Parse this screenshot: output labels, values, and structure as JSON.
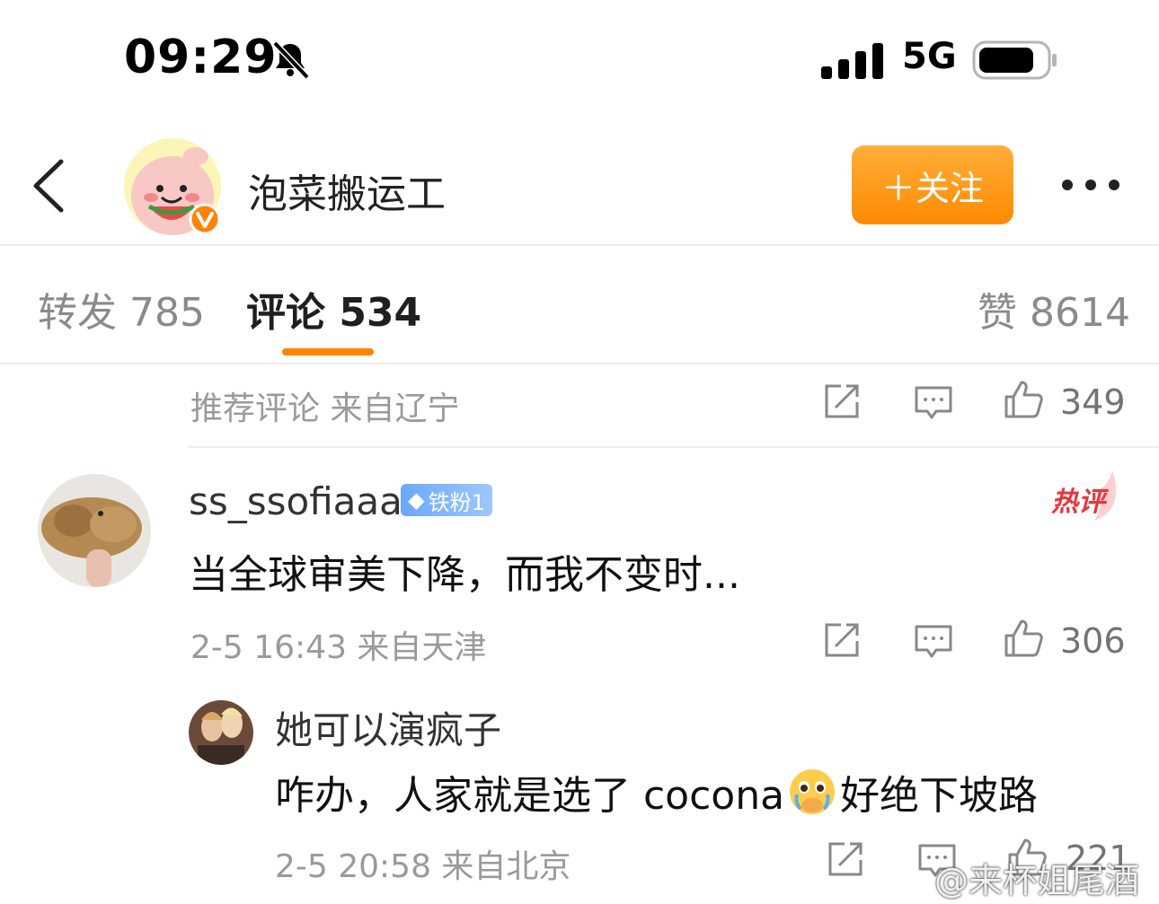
{
  "status_bar": {
    "time": "09:29",
    "network": "5G"
  },
  "header": {
    "username": "泡菜搬运工",
    "follow_label": "＋关注"
  },
  "tabs": {
    "repost": "转发 785",
    "comments": "评论 534",
    "likes": "赞 8614"
  },
  "recommended": {
    "meta": "推荐评论  来自辽宁",
    "like_count": "349"
  },
  "comment": {
    "username": "ss_ssofiaaa",
    "badge": "铁粉1",
    "hot_label": "热评",
    "text": "当全球审美下降，而我不变时...",
    "meta": "2-5 16:43  来自天津",
    "like_count": "306"
  },
  "reply": {
    "username": "她可以演疯子",
    "text_before": "咋办，人家就是选了 cocona",
    "text_after": "好绝下坡路",
    "emoji": "teary-pleading-emoji",
    "meta": "2-5 20:58  来自北京",
    "like_count": "221"
  },
  "watermark": "@来杯姐尾酒",
  "colors": {
    "accent": "#ff8200",
    "badge_blue": "#6aa9ff",
    "hot_red": "#e8363e"
  }
}
